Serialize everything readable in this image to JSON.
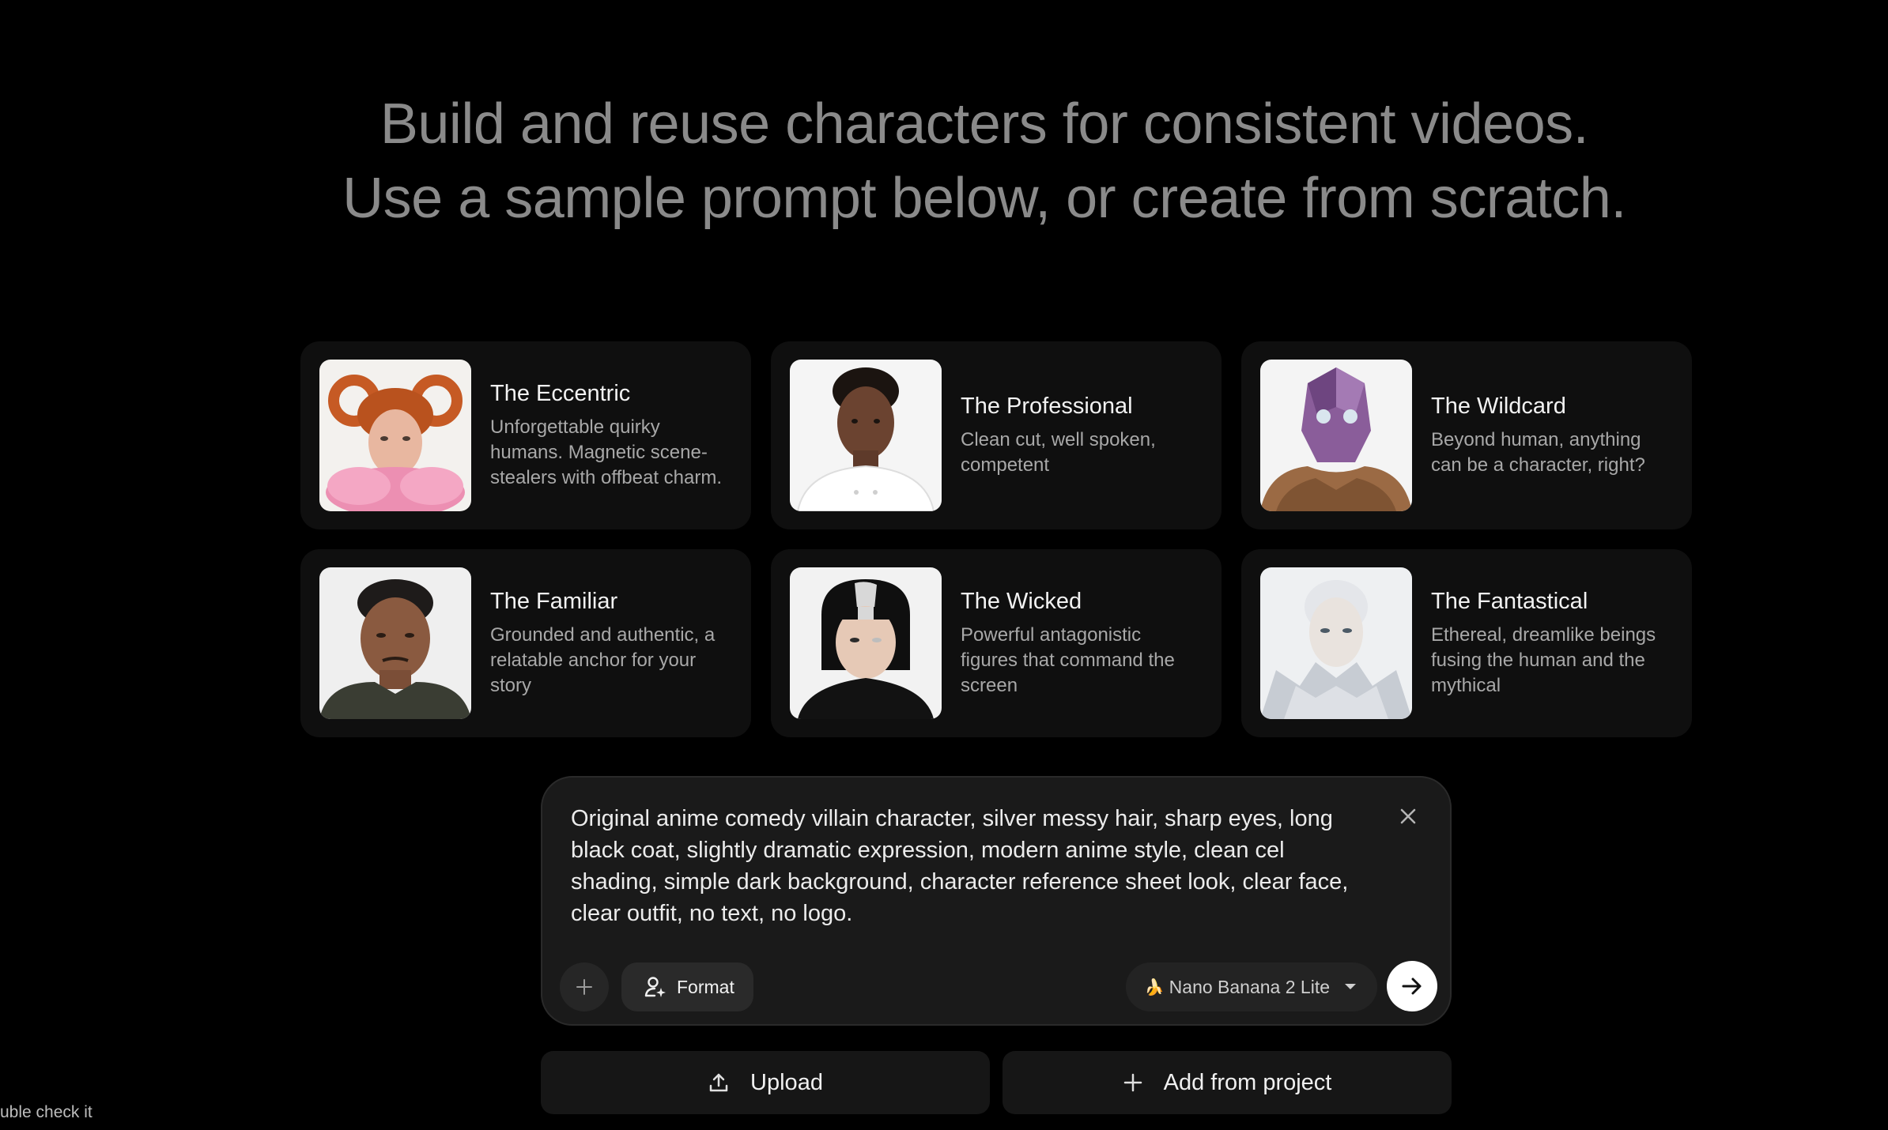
{
  "headline": {
    "line1": "Build and reuse characters for consistent videos.",
    "line2": "Use a sample prompt below, or create from scratch."
  },
  "cards": [
    {
      "title": "The Eccentric",
      "description": "Unforgettable quirky humans. Magnetic scene-stealers with offbeat charm."
    },
    {
      "title": "The Professional",
      "description": "Clean cut, well spoken, competent"
    },
    {
      "title": "The Wildcard",
      "description": "Beyond human, anything can be a character, right?"
    },
    {
      "title": "The Familiar",
      "description": "Grounded and authentic, a relatable anchor for your story"
    },
    {
      "title": "The Wicked",
      "description": "Powerful antagonistic figures that command the screen"
    },
    {
      "title": "The Fantastical",
      "description": "Ethereal, dreamlike beings fusing the human and the mythical"
    }
  ],
  "prompt": {
    "text": "Original anime comedy villain character, silver messy hair, sharp eyes, long black coat, slightly dramatic expression, modern anime style, clean cel shading, simple dark background, character reference sheet look, clear face, clear outfit, no text, no logo.",
    "format_label": "Format",
    "model_label": "Nano Banana 2 Lite",
    "model_icon": "🍌"
  },
  "actions": {
    "upload_label": "Upload",
    "add_from_project_label": "Add from project"
  },
  "corner_text": "uble check it",
  "icons": {
    "close": "close-icon",
    "plus": "plus-icon",
    "format": "person-sparkle-icon",
    "caret": "caret-down-icon",
    "send": "arrow-right-icon",
    "upload": "upload-icon",
    "add": "plus-icon"
  }
}
